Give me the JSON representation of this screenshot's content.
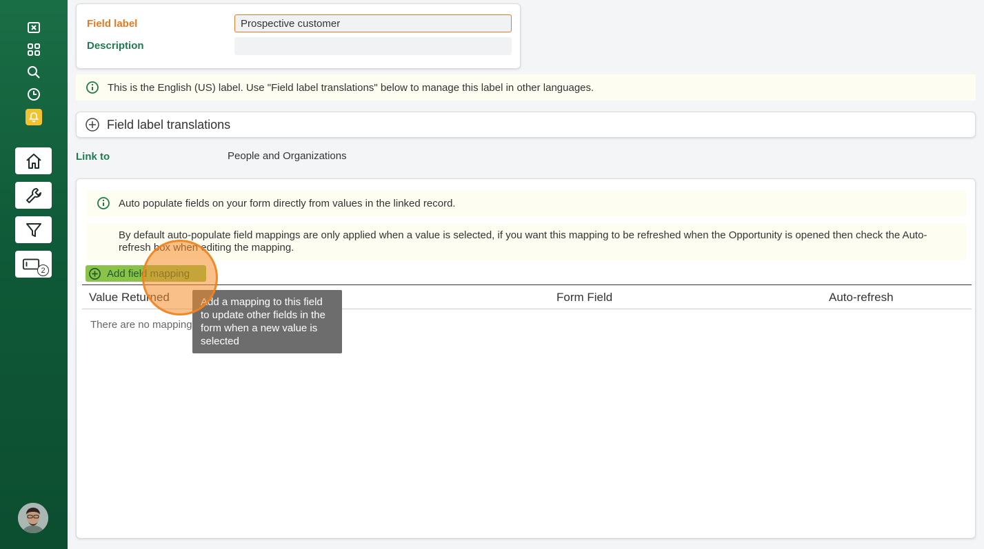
{
  "form": {
    "field_label": {
      "label": "Field label",
      "value": "Prospective customer"
    },
    "description": {
      "label": "Description",
      "value": ""
    }
  },
  "info_banner": {
    "text": "This is the English (US) label. Use \"Field label translations\" below to manage this label in other languages."
  },
  "translations_accordion": {
    "label": "Field label translations"
  },
  "link_to": {
    "label": "Link to",
    "value": "People and Organizations"
  },
  "mapping_panel": {
    "note_auto_populate": "Auto populate fields on your form directly from values in the linked record.",
    "note_default": "By default auto-populate field mappings are only applied when a value is selected, if you want this mapping to be refreshed when the Opportunity is opened then check the Auto-refresh box when editing the mapping.",
    "add_button_label": "Add field mapping",
    "columns": [
      "Value Returned",
      "Form Field",
      "Auto-refresh"
    ],
    "empty_text": "There are no mappings",
    "tooltip": "Add a mapping to this field to update other fields in the form when a new value is selected"
  },
  "sidebar": {
    "tile_badge": "2",
    "icons": [
      "close-box-icon",
      "apps-grid-icon",
      "search-icon",
      "history-clock-icon",
      "bell-icon",
      "home-icon",
      "wrench-icon",
      "filter-icon",
      "ticket-icon"
    ]
  },
  "colors": {
    "sidebar": "#0f5a38",
    "accent_orange": "#e07b22",
    "label_green": "#1f7a4f",
    "button_green": "#8bc34a"
  }
}
